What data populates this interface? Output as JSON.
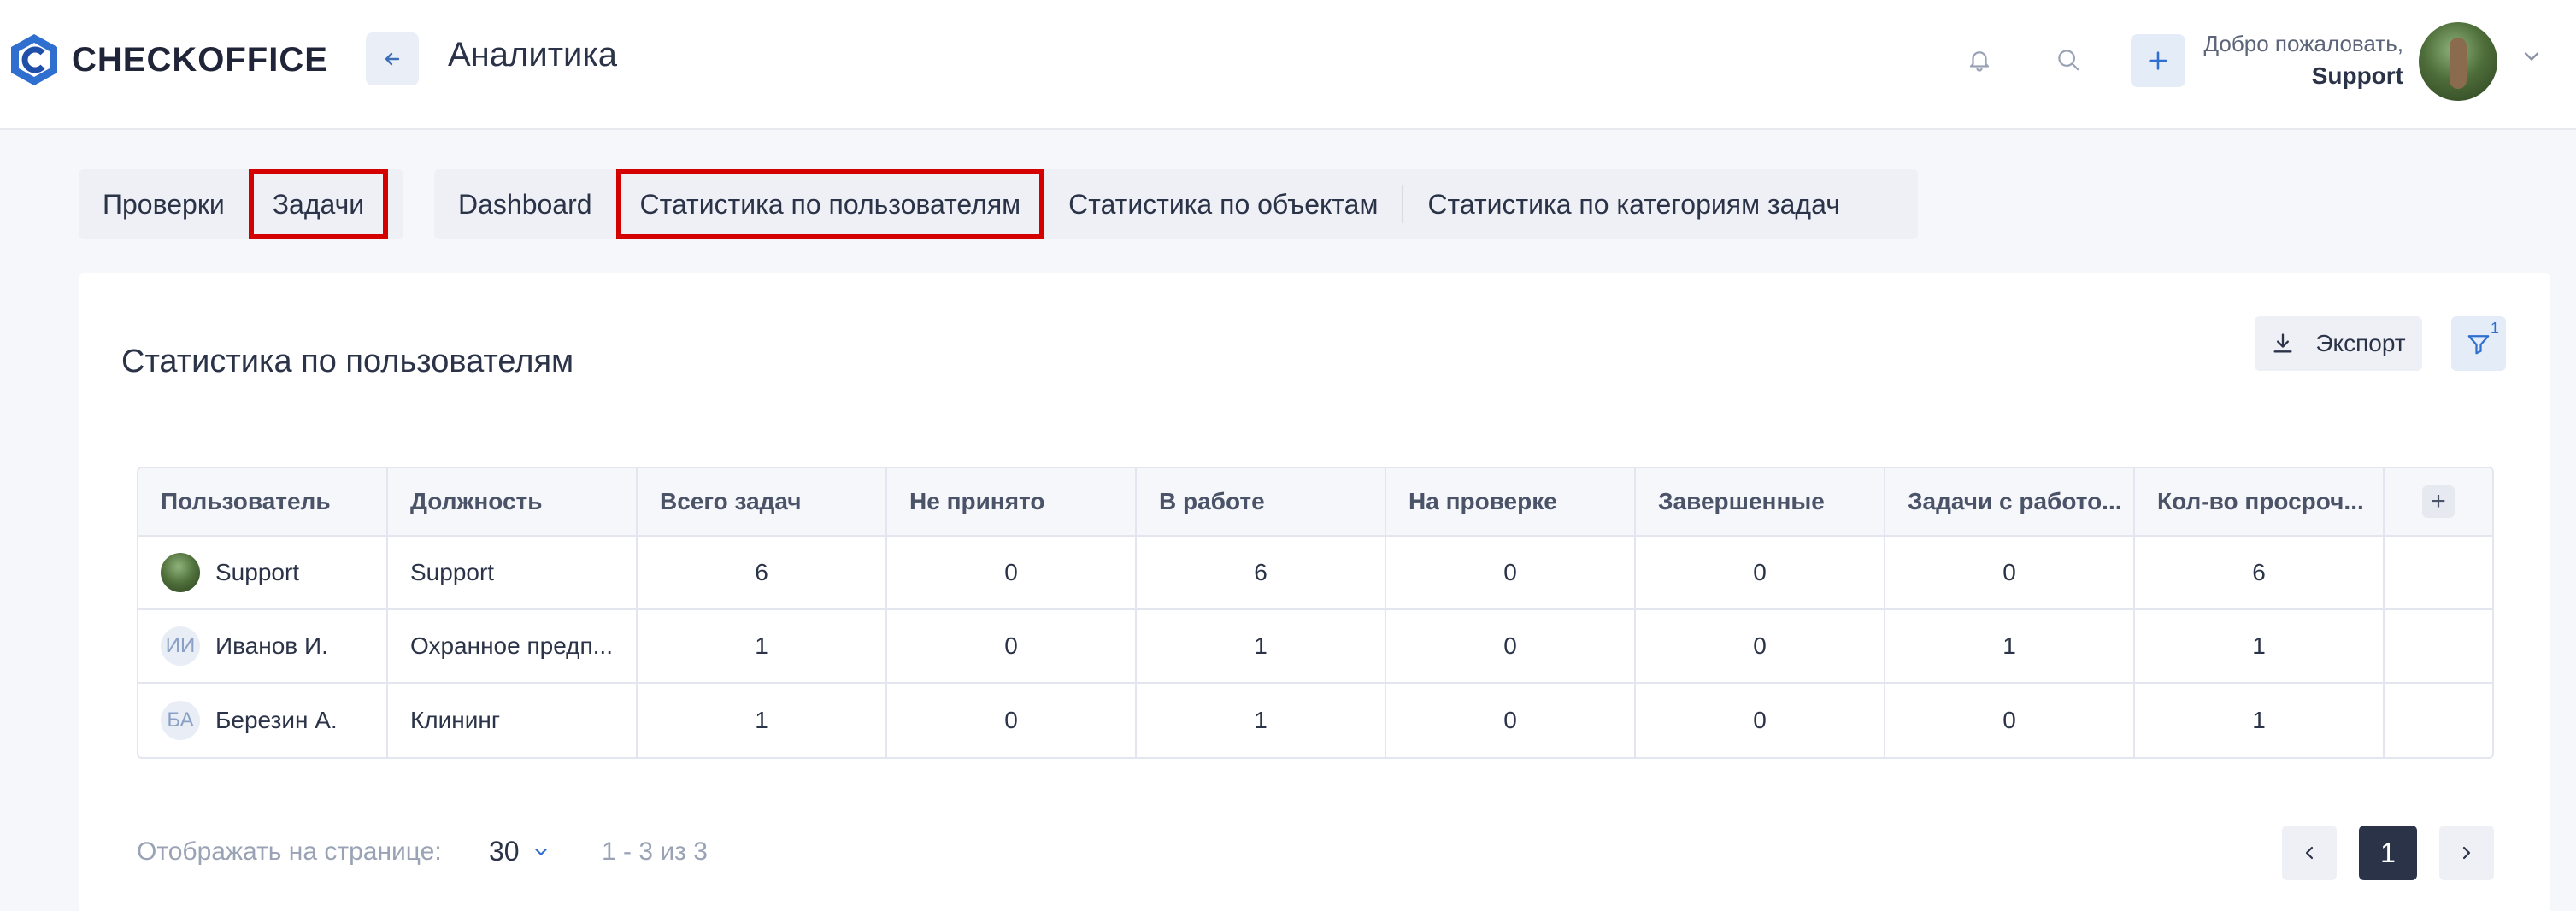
{
  "app": {
    "brand": "CHECKOFFICE",
    "page_title": "Аналитика"
  },
  "header": {
    "welcome": "Добро пожаловать,",
    "user": "Support"
  },
  "tabs_primary": [
    {
      "label": "Проверки",
      "highlighted": false
    },
    {
      "label": "Задачи",
      "highlighted": true
    }
  ],
  "tabs_secondary": [
    {
      "label": "Dashboard",
      "highlighted": false
    },
    {
      "label": "Статистика по пользователям",
      "highlighted": true
    },
    {
      "label": "Статистика по объектам",
      "highlighted": false
    },
    {
      "label": "Статистика по категориям задач",
      "highlighted": false
    }
  ],
  "card": {
    "title": "Статистика по пользователям",
    "export_label": "Экспорт",
    "filter_count": "1"
  },
  "table": {
    "columns": [
      "Пользователь",
      "Должность",
      "Всего задач",
      "Не принято",
      "В работе",
      "На проверке",
      "Завершенные",
      "Задачи с работо...",
      "Кол-во просроч..."
    ],
    "add_column_label": "+",
    "rows": [
      {
        "avatar": "photo",
        "initials": "",
        "user": "Support",
        "position": "Support",
        "values": [
          "6",
          "0",
          "6",
          "0",
          "0",
          "0",
          "6"
        ]
      },
      {
        "avatar": "initials",
        "initials": "ИИ",
        "user": "Иванов И.",
        "position": "Охранное предп...",
        "values": [
          "1",
          "0",
          "1",
          "0",
          "0",
          "1",
          "1"
        ]
      },
      {
        "avatar": "initials",
        "initials": "БА",
        "user": "Березин А.",
        "position": "Клининг",
        "values": [
          "1",
          "0",
          "1",
          "0",
          "0",
          "0",
          "1"
        ]
      }
    ]
  },
  "pagination": {
    "per_page_label": "Отображать на странице:",
    "per_page_value": "30",
    "range": "1 - 3 из 3",
    "current_page": "1"
  },
  "colors": {
    "accent": "#2f6fd0",
    "highlight": "#d40000",
    "dark": "#2b3348"
  }
}
